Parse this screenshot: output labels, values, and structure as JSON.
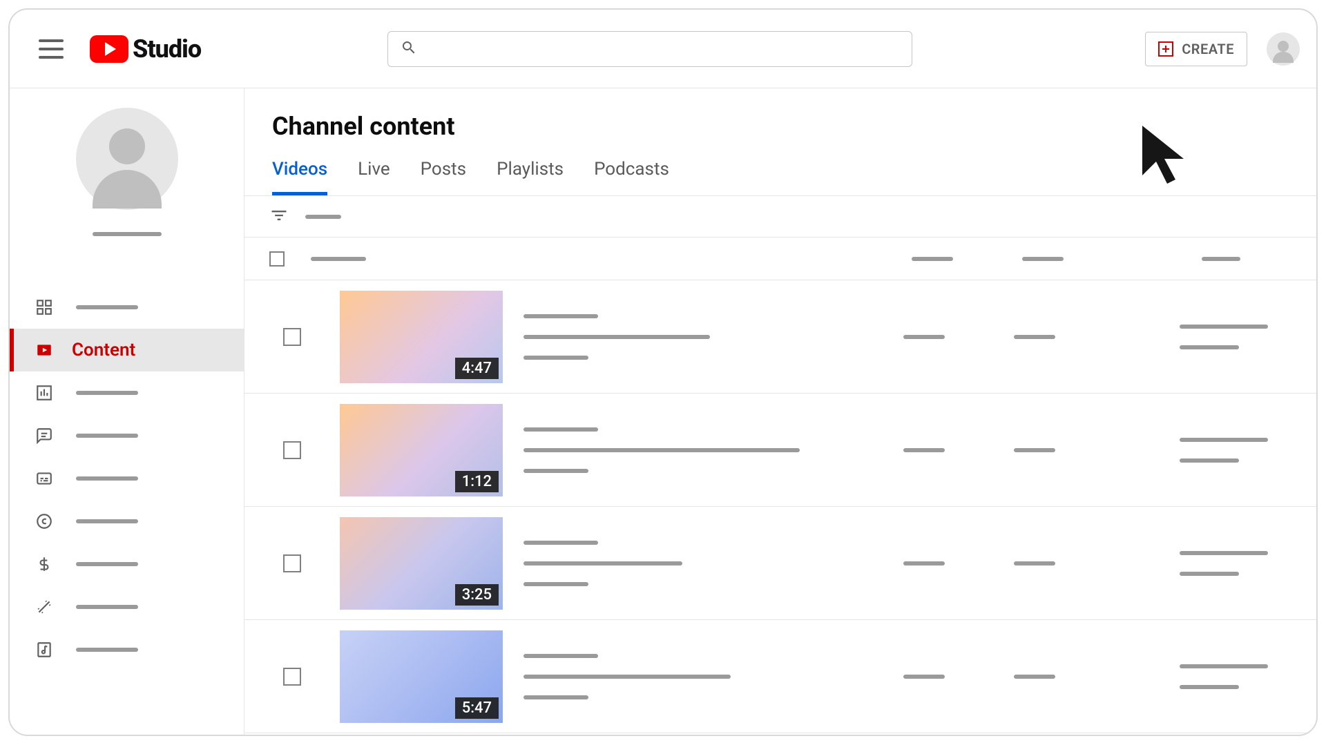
{
  "header": {
    "logo_text": "Studio",
    "search_placeholder": "",
    "create_label": "CREATE"
  },
  "sidebar": {
    "active_label": "Content",
    "items": [
      {
        "icon": "dashboard-icon",
        "active": false
      },
      {
        "icon": "content-icon",
        "label": "Content",
        "active": true
      },
      {
        "icon": "analytics-icon",
        "active": false
      },
      {
        "icon": "comments-icon",
        "active": false
      },
      {
        "icon": "subtitles-icon",
        "active": false
      },
      {
        "icon": "copyright-icon",
        "active": false
      },
      {
        "icon": "earn-icon",
        "active": false
      },
      {
        "icon": "customize-icon",
        "active": false
      },
      {
        "icon": "audio-icon",
        "active": false
      }
    ]
  },
  "main": {
    "page_title": "Channel content",
    "tabs": [
      {
        "label": "Videos",
        "active": true
      },
      {
        "label": "Live",
        "active": false
      },
      {
        "label": "Posts",
        "active": false
      },
      {
        "label": "Playlists",
        "active": false
      },
      {
        "label": "Podcasts",
        "active": false
      }
    ],
    "videos": [
      {
        "duration": "4:47",
        "thumb_class": "v1",
        "desc_w": 270
      },
      {
        "duration": "1:12",
        "thumb_class": "v2",
        "desc_w": 400
      },
      {
        "duration": "3:25",
        "thumb_class": "v3",
        "desc_w": 230
      },
      {
        "duration": "5:47",
        "thumb_class": "v4",
        "desc_w": 300
      }
    ]
  }
}
